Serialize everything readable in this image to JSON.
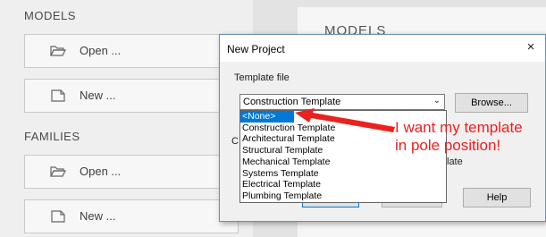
{
  "start_screen": {
    "models_label": "MODELS",
    "families_label": "FAMILIES",
    "models_tiles": [
      {
        "label": "Open ...",
        "icon": "folder-open-icon"
      },
      {
        "label": "New ...",
        "icon": "new-file-icon"
      }
    ],
    "families_tiles": [
      {
        "label": "Open ...",
        "icon": "folder-open-icon"
      },
      {
        "label": "New ...",
        "icon": "new-file-icon"
      }
    ],
    "right_models_label": "MODELS"
  },
  "dialog": {
    "title": "New Project",
    "close_glyph": "×",
    "template_group_label": "Template file",
    "selected_template": "Construction Template",
    "browse_label": "Browse...",
    "create_new_partial": "C",
    "radio_partial_text": "late",
    "help_label": "Help",
    "dropdown_options": [
      "<None>",
      "Construction Template",
      "Architectural Template",
      "Structural Template",
      "Mechanical Template",
      "Systems Template",
      "Electrical Template",
      "Plumbing Template"
    ],
    "highlighted_option_index": 0
  },
  "annotation": {
    "line1": "I want my template",
    "line2": "in pole position!",
    "color": "#e8221f"
  },
  "colors": {
    "selection_blue": "#0078d7",
    "dialog_border": "#6b8fb5"
  }
}
